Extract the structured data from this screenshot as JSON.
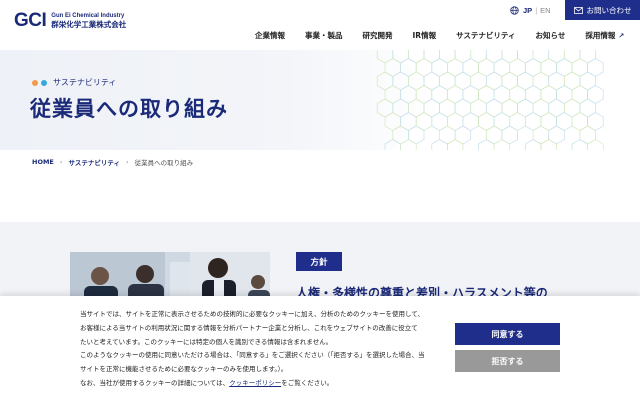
{
  "header": {
    "logo_mark": "GCI",
    "logo_en": "Gun Ei Chemical Industry",
    "logo_jp": "群栄化学工業株式会社",
    "lang_jp": "JP",
    "lang_en": "EN",
    "contact_label": "お問い合わせ",
    "nav": [
      {
        "label": "企業情報"
      },
      {
        "label": "事業・製品"
      },
      {
        "label": "研究開発"
      },
      {
        "label": "IR情報"
      },
      {
        "label": "サステナビリティ"
      },
      {
        "label": "お知らせ"
      },
      {
        "label": "採用情報"
      }
    ]
  },
  "hero": {
    "subtitle": "サステナビリティ",
    "title": "従業員への取り組み"
  },
  "breadcrumb": {
    "home": "HOME",
    "section": "サステナビリティ",
    "current": "従業員への取り組み"
  },
  "main": {
    "badge": "方針",
    "heading": "人権・多様性の尊重と差別・ハラスメント等の"
  },
  "cookie": {
    "line1": "当サイトでは、サイトを正常に表示させるための技術的に必要なクッキーに加え、分析のためのクッキーを使用して、",
    "line2": "お客様による当サイトの利用状況に関する情報を分析パートナー企業と分析し、これをウェブサイトの改善に役立て",
    "line3": "たいと考えています。このクッキーには特定の個人を識別できる情報は含まれません。",
    "line4": "このようなクッキーの使用に同意いただける場合は、「同意する」をご選択ください（「拒否する」を選択した場合、当",
    "line5": "サイトを正常に機能させるために必要なクッキーのみを使用します。）。",
    "line6_before": "なお、当社が使用するクッキーの詳細については、",
    "policy_link": "クッキーポリシー",
    "line6_after": "をご覧ください。",
    "agree_label": "同意する",
    "reject_label": "拒否する"
  },
  "colors": {
    "brand": "#1b2a78",
    "button": "#1f2e8a",
    "reject": "#999999",
    "section_bg": "#f2f3f6"
  }
}
